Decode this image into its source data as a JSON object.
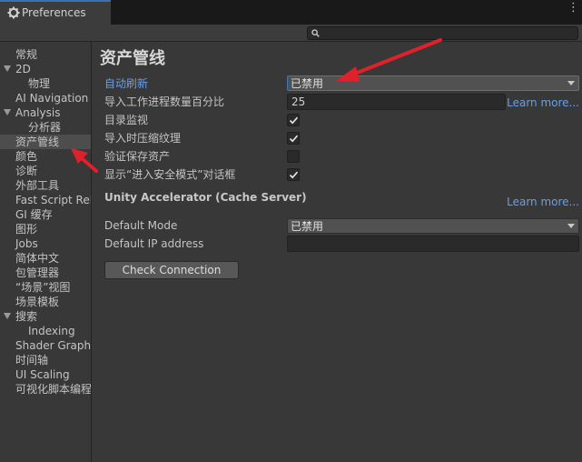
{
  "window": {
    "tab_title": "Preferences"
  },
  "search": {
    "placeholder": ""
  },
  "sidebar": {
    "items": [
      {
        "label": "常规",
        "indent": 1,
        "arrow": false
      },
      {
        "label": "2D",
        "indent": 1,
        "arrow": true
      },
      {
        "label": "物理",
        "indent": 2,
        "arrow": false
      },
      {
        "label": "AI Navigation",
        "indent": 1,
        "arrow": false
      },
      {
        "label": "Analysis",
        "indent": 1,
        "arrow": true
      },
      {
        "label": "分析器",
        "indent": 2,
        "arrow": false
      },
      {
        "label": "资产管线",
        "indent": 1,
        "arrow": false,
        "selected": true
      },
      {
        "label": "颜色",
        "indent": 1,
        "arrow": false
      },
      {
        "label": "诊断",
        "indent": 1,
        "arrow": false
      },
      {
        "label": "外部工具",
        "indent": 1,
        "arrow": false
      },
      {
        "label": "Fast Script Reload",
        "indent": 1,
        "arrow": false
      },
      {
        "label": "GI 缓存",
        "indent": 1,
        "arrow": false
      },
      {
        "label": "图形",
        "indent": 1,
        "arrow": false
      },
      {
        "label": "Jobs",
        "indent": 1,
        "arrow": false
      },
      {
        "label": "简体中文",
        "indent": 1,
        "arrow": false
      },
      {
        "label": "包管理器",
        "indent": 1,
        "arrow": false
      },
      {
        "label": "“场景”视图",
        "indent": 1,
        "arrow": false
      },
      {
        "label": "场景模板",
        "indent": 1,
        "arrow": false
      },
      {
        "label": "搜索",
        "indent": 1,
        "arrow": true
      },
      {
        "label": "Indexing",
        "indent": 2,
        "arrow": false
      },
      {
        "label": "Shader Graph",
        "indent": 1,
        "arrow": false
      },
      {
        "label": "时间轴",
        "indent": 1,
        "arrow": false
      },
      {
        "label": "UI Scaling",
        "indent": 1,
        "arrow": false
      },
      {
        "label": "可视化脚本编程",
        "indent": 1,
        "arrow": false
      }
    ]
  },
  "main": {
    "title": "资产管线",
    "auto_refresh": {
      "label": "自动刷新",
      "value": "已禁用"
    },
    "import_worker": {
      "label": "导入工作进程数量百分比",
      "value": "25",
      "learn_more": "Learn more..."
    },
    "directory_monitoring": {
      "label": "目录监视",
      "checked": true
    },
    "compress_on_import": {
      "label": "导入时压缩纹理",
      "checked": true
    },
    "verify_saving": {
      "label": "验证保存资产",
      "checked": false
    },
    "safe_mode_dialog": {
      "label": "显示“进入安全模式”对话框",
      "checked": true
    },
    "accelerator": {
      "header": "Unity Accelerator (Cache Server)",
      "learn_more": "Learn more...",
      "default_mode": {
        "label": "Default Mode",
        "value": "已禁用"
      },
      "default_ip": {
        "label": "Default IP address",
        "value": ""
      },
      "check_button": "Check Connection"
    }
  },
  "colors": {
    "accent_blue": "#6a9ee6",
    "annotation_red": "#e0202a"
  }
}
